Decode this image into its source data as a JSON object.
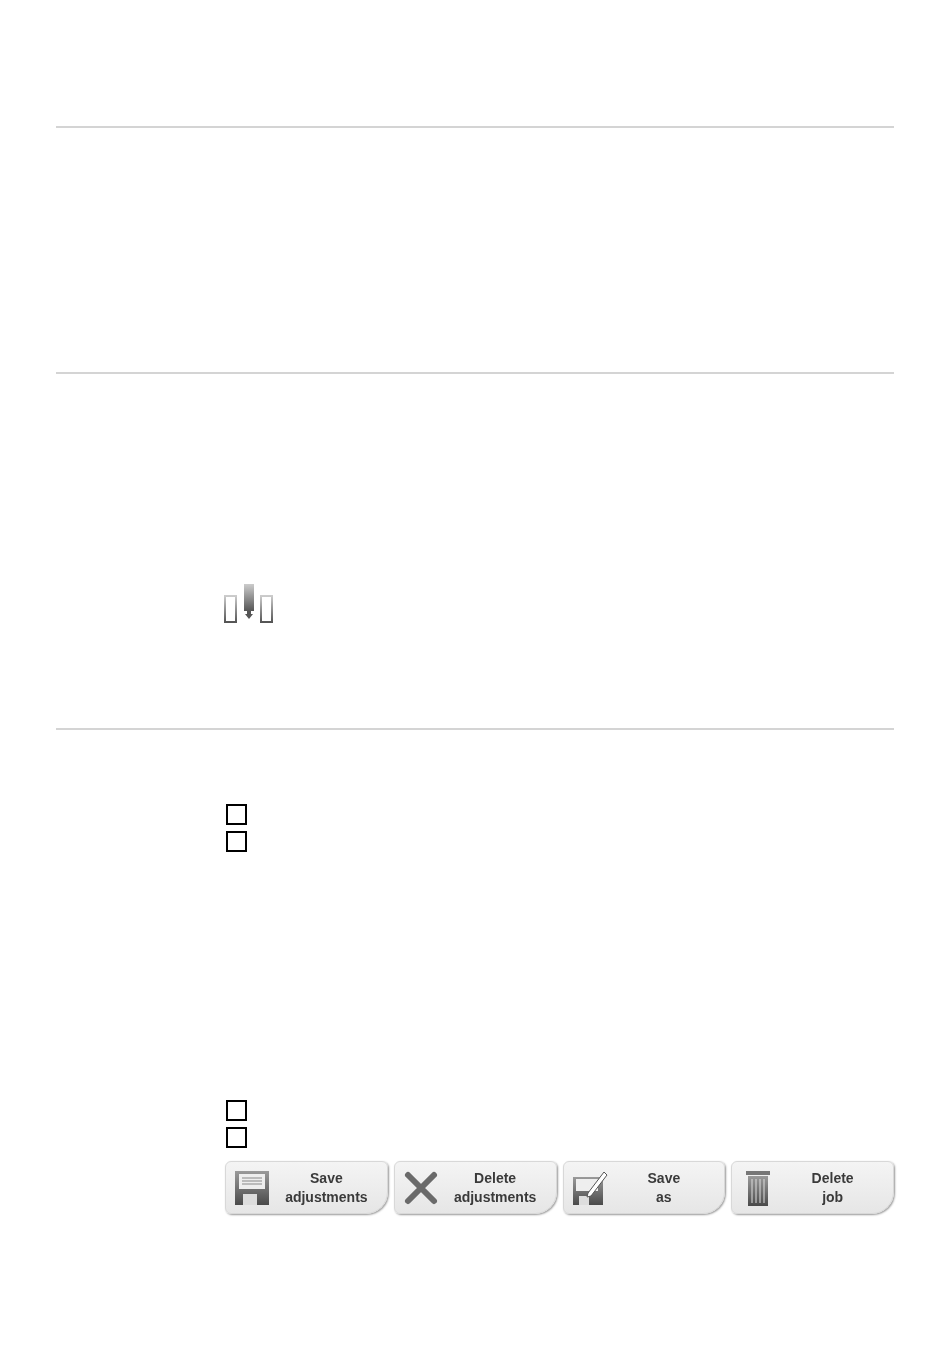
{
  "checkbox_groups": [
    [
      {
        "checked": false
      },
      {
        "checked": false
      }
    ],
    [
      {
        "checked": false
      },
      {
        "checked": false
      }
    ]
  ],
  "buttons": [
    {
      "kind": "save",
      "label": "Save adjustments"
    },
    {
      "kind": "delete",
      "label": "Delete adjustments"
    },
    {
      "kind": "save-as",
      "label": "Save as"
    },
    {
      "kind": "trash",
      "label": "Delete job"
    }
  ]
}
